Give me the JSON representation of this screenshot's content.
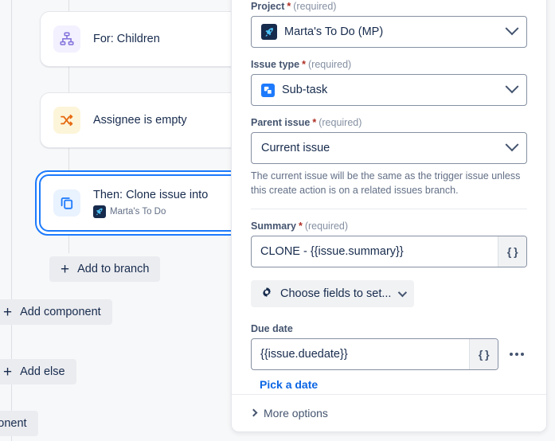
{
  "canvas": {
    "nodes": [
      {
        "id": "for-children",
        "title": "For: Children",
        "sub": "",
        "icon": "branch-icon",
        "icon_bg": "#f3f0ff",
        "icon_color": "#8270db",
        "selected": false
      },
      {
        "id": "assignee-is-empty",
        "title": "Assignee is empty",
        "sub": "",
        "icon": "shuffle-icon",
        "icon_bg": "#fdf5d9",
        "icon_color": "#e56910",
        "selected": false
      },
      {
        "id": "then-clone-issue-into",
        "title": "Then: Clone issue into",
        "sub": "Marta's To Do",
        "icon": "copy-icon",
        "icon_bg": "#e9f2ff",
        "icon_color": "#1d7afc",
        "selected": true
      }
    ],
    "buttons": {
      "add_to_branch": "Add to branch",
      "add_component": "Add component",
      "add_else": "Add else",
      "add_component_2": "mponent"
    },
    "plus_glyph": "+"
  },
  "panel": {
    "project": {
      "label": "Project",
      "required_star": "*",
      "required_text": "(required)",
      "value": "Marta's To Do (MP)"
    },
    "issue_type": {
      "label": "Issue type",
      "required_star": "*",
      "required_text": "(required)",
      "value": "Sub-task"
    },
    "parent_issue": {
      "label": "Parent issue",
      "required_star": "*",
      "required_text": "(required)",
      "value": "Current issue",
      "helper": "The current issue will be the same as the trigger issue unless this create action is on a related issues branch."
    },
    "summary": {
      "label": "Summary",
      "required_star": "*",
      "required_text": "(required)",
      "value": "CLONE - {{issue.summary}}",
      "smart_value_button": "{ }"
    },
    "choose_fields": {
      "label": "Choose fields to set...",
      "icon": "gear-icon"
    },
    "due_date": {
      "label": "Due date",
      "value": "{{issue.duedate}}",
      "smart_value_button": "{ }",
      "pick_a_date": "Pick a date"
    },
    "more_options": {
      "label": "More options"
    }
  },
  "colors": {
    "accent_blue": "#1d7afc",
    "link_blue": "#0c66e4",
    "required_red": "#ae2e24",
    "canvas_bg": "#f7f8f9"
  }
}
